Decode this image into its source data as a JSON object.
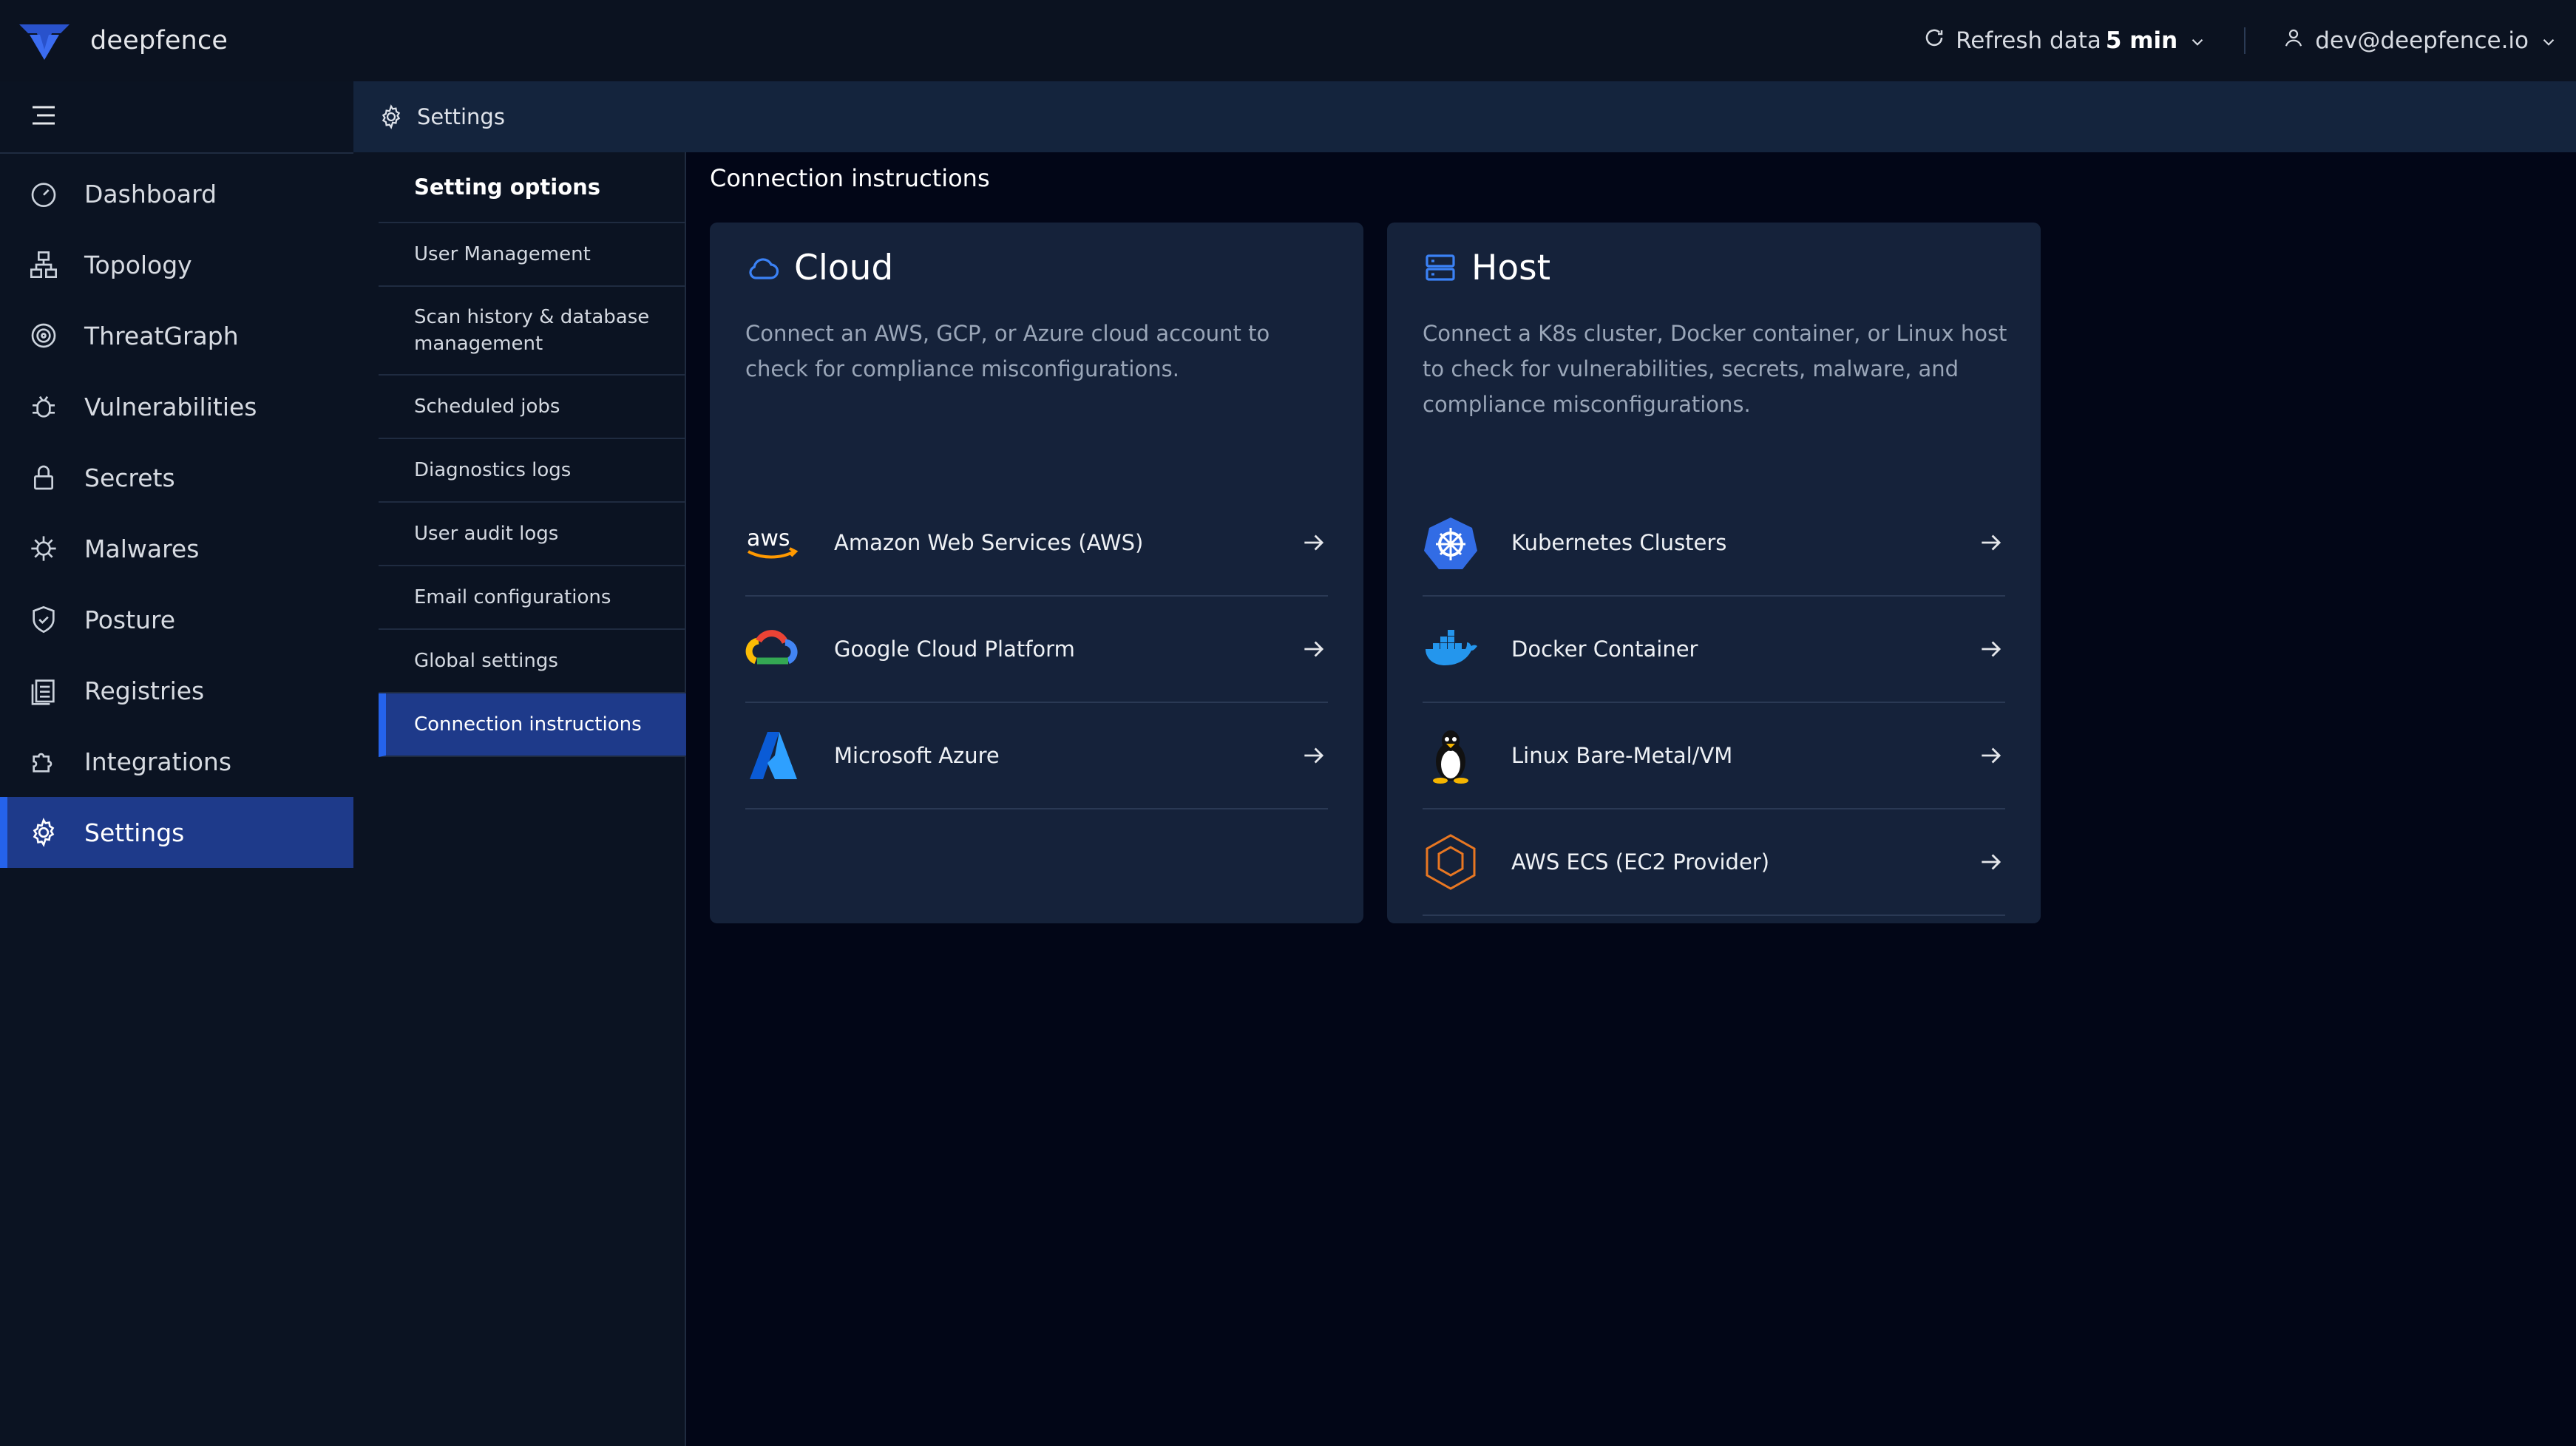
{
  "app": {
    "name": "deepfence"
  },
  "topbar": {
    "refresh_label": "Refresh data",
    "refresh_value": "5 min",
    "user_email": "dev@deepfence.io"
  },
  "sidebar": {
    "items": [
      {
        "label": "Dashboard",
        "icon": "dashboard-icon"
      },
      {
        "label": "Topology",
        "icon": "topology-icon"
      },
      {
        "label": "ThreatGraph",
        "icon": "threatgraph-icon"
      },
      {
        "label": "Vulnerabilities",
        "icon": "bug-icon"
      },
      {
        "label": "Secrets",
        "icon": "lock-icon"
      },
      {
        "label": "Malwares",
        "icon": "malware-icon"
      },
      {
        "label": "Posture",
        "icon": "shield-icon"
      },
      {
        "label": "Registries",
        "icon": "registries-icon"
      },
      {
        "label": "Integrations",
        "icon": "puzzle-icon"
      },
      {
        "label": "Settings",
        "icon": "gear-icon",
        "active": true
      }
    ]
  },
  "breadcrumb": {
    "label": "Settings"
  },
  "options": {
    "header": "Setting options",
    "items": [
      "User Management",
      "Scan history & database management",
      "Scheduled jobs",
      "Diagnostics logs",
      "User audit logs",
      "Email configurations",
      "Global settings",
      "Connection instructions"
    ],
    "active_index": 7
  },
  "main": {
    "title": "Connection instructions",
    "cloud": {
      "title": "Cloud",
      "description": "Connect an AWS, GCP, or Azure cloud account to check for compliance misconfigurations.",
      "rows": [
        "Amazon Web Services (AWS)",
        "Google Cloud Platform",
        "Microsoft Azure"
      ]
    },
    "host": {
      "title": "Host",
      "description": "Connect a K8s cluster, Docker container, or Linux host to check for vulnerabilities, secrets, malware, and compliance misconfigurations.",
      "rows": [
        "Kubernetes Clusters",
        "Docker Container",
        "Linux Bare-Metal/VM",
        "AWS ECS (EC2 Provider)"
      ]
    }
  },
  "colors": {
    "accent": "#2563eb",
    "active_bg": "#1e3a8a",
    "card_bg": "#15223a",
    "page_bg": "#020617"
  }
}
